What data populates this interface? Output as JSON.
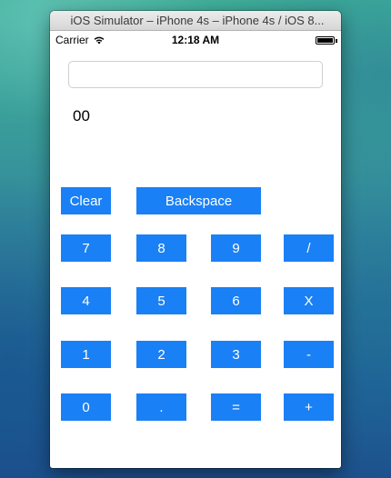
{
  "window": {
    "title": "iOS Simulator – iPhone 4s – iPhone 4s / iOS 8..."
  },
  "status_bar": {
    "carrier": "Carrier",
    "time": "12:18 AM",
    "wifi_icon": "wifi-icon",
    "battery_icon": "battery-icon",
    "battery_level_fraction": 1.0
  },
  "calculator": {
    "input_value": "",
    "input_placeholder": "",
    "display_value": "00",
    "button_color": "#1a80f5",
    "button_text_color": "#ffffff",
    "keys": {
      "clear": "Clear",
      "backspace": "Backspace",
      "seven": "7",
      "eight": "8",
      "nine": "9",
      "divide": "/",
      "four": "4",
      "five": "5",
      "six": "6",
      "multiply": "X",
      "one": "1",
      "two": "2",
      "three": "3",
      "minus": "-",
      "zero": "0",
      "decimal": ".",
      "equals": "=",
      "plus": "+"
    }
  }
}
